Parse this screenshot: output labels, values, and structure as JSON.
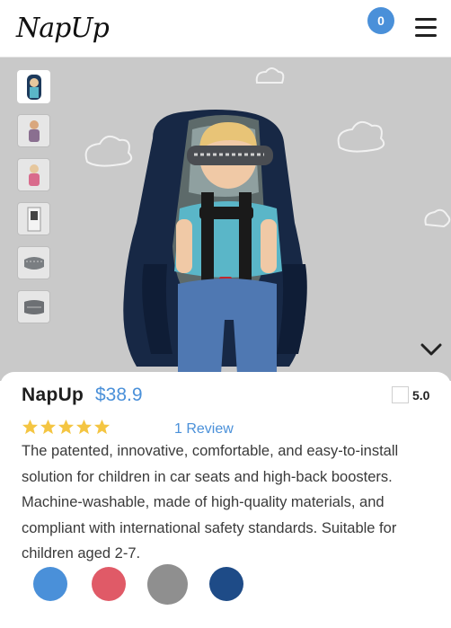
{
  "header": {
    "logo": "NapUp",
    "cart_count": "0"
  },
  "hero": {
    "thumbnails": [
      {
        "name": "car-seat-child-photo"
      },
      {
        "name": "child-sitting-photo"
      },
      {
        "name": "child-sleeping-photo"
      },
      {
        "name": "package-photo"
      },
      {
        "name": "head-support-photo"
      },
      {
        "name": "product-detail-photo"
      }
    ]
  },
  "product": {
    "title": "NapUp",
    "price": "$38.9",
    "rating": "5.0",
    "stars": 5,
    "reviews": "1 Review",
    "description": "The patented, innovative, comfortable, and easy-to-install solution for children in car seats and high-back boosters. Machine-washable, made of high-quality materials, and compliant with international safety standards. Suitable for children aged 2-7.",
    "colors": [
      "#4a90d9",
      "#e05a67",
      "#8f8f8f",
      "#1e4b87"
    ]
  },
  "theme": {
    "accent": "#4a90d9"
  }
}
